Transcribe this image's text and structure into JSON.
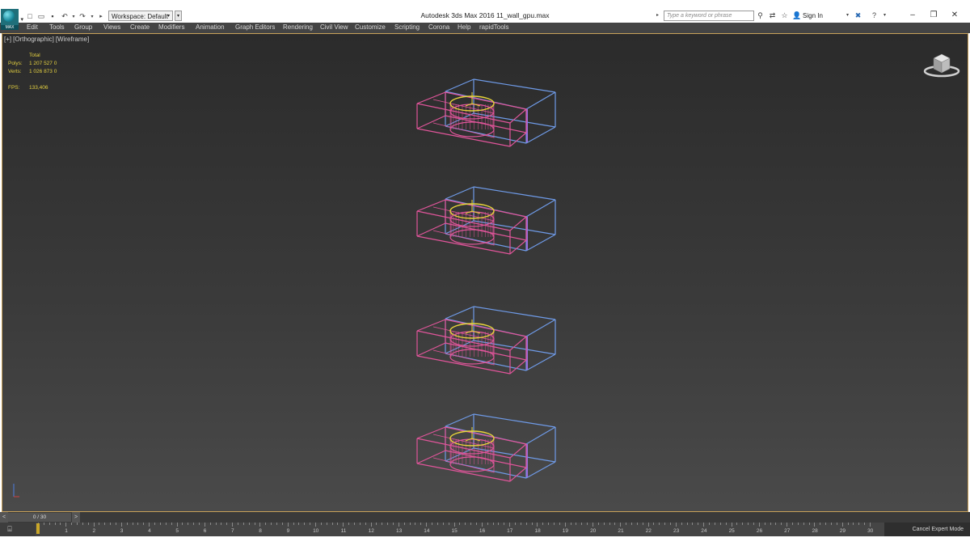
{
  "app": {
    "logo_label": "MAX",
    "title": "Autodesk 3ds Max 2016    11_wall_gpu.max"
  },
  "toolbar": {
    "workspace_label": "Workspace: Default",
    "search_placeholder": "Type a keyword or phrase",
    "sign_in": "Sign In"
  },
  "menu": [
    "Edit",
    "Tools",
    "Group",
    "Views",
    "Create",
    "Modifiers",
    "Animation",
    "Graph Editors",
    "Rendering",
    "Civil View",
    "Customize",
    "Scripting",
    "Corona",
    "Help",
    "rapidTools"
  ],
  "viewport": {
    "label_plus": "[+]",
    "label_view": "[Orthographic]",
    "label_mode": "[Wireframe]",
    "stats": {
      "total_label": "Total",
      "polys_label": "Polys:",
      "polys_value": "1 207 527  0",
      "verts_label": "Verts:",
      "verts_value": "1 026 873  0",
      "fps_label": "FPS:",
      "fps_value": "133,406"
    }
  },
  "timeline": {
    "frame_display": "0 / 30",
    "ticks": [
      "1",
      "2",
      "3",
      "4",
      "5",
      "6",
      "7",
      "8",
      "9",
      "10",
      "11",
      "12",
      "13",
      "14",
      "15",
      "16",
      "17",
      "18",
      "19",
      "20",
      "21",
      "22",
      "23",
      "24",
      "25",
      "26",
      "27",
      "28",
      "29",
      "30"
    ],
    "cancel_expert": "Cancel Expert Mode"
  },
  "colors": {
    "menubar_bg": "#444444",
    "viewport_border": "#c8a15a",
    "stats_text": "#e4d040",
    "wire_pink": "#e0559a",
    "wire_blue": "#6f9be8",
    "wire_yellow": "#e8d43a",
    "wire_purple": "#9b6fe0"
  },
  "icons": [
    "app-logo-icon",
    "new-file-icon",
    "open-file-icon",
    "save-icon",
    "undo-icon",
    "redo-icon",
    "binoculars-icon",
    "exchange-icon",
    "star-icon",
    "user-icon",
    "close-x-icon",
    "help-icon",
    "minimize-icon",
    "restore-icon",
    "close-window-icon",
    "viewcube-icon",
    "axis-gizmo-icon",
    "track-key-icon"
  ]
}
